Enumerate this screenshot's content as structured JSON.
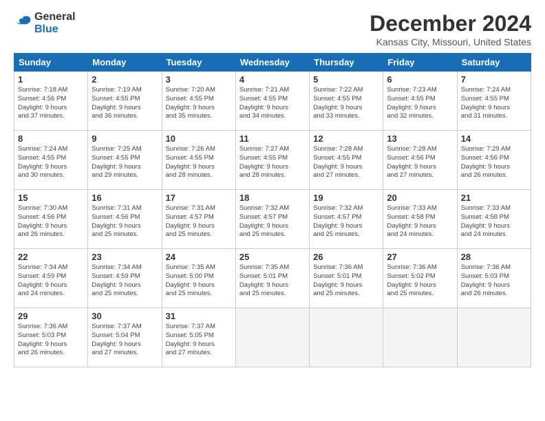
{
  "header": {
    "logo_line1": "General",
    "logo_line2": "Blue",
    "month_title": "December 2024",
    "location": "Kansas City, Missouri, United States"
  },
  "weekdays": [
    "Sunday",
    "Monday",
    "Tuesday",
    "Wednesday",
    "Thursday",
    "Friday",
    "Saturday"
  ],
  "weeks": [
    [
      {
        "day": "1",
        "info": "Sunrise: 7:18 AM\nSunset: 4:56 PM\nDaylight: 9 hours\nand 37 minutes."
      },
      {
        "day": "2",
        "info": "Sunrise: 7:19 AM\nSunset: 4:55 PM\nDaylight: 9 hours\nand 36 minutes."
      },
      {
        "day": "3",
        "info": "Sunrise: 7:20 AM\nSunset: 4:55 PM\nDaylight: 9 hours\nand 35 minutes."
      },
      {
        "day": "4",
        "info": "Sunrise: 7:21 AM\nSunset: 4:55 PM\nDaylight: 9 hours\nand 34 minutes."
      },
      {
        "day": "5",
        "info": "Sunrise: 7:22 AM\nSunset: 4:55 PM\nDaylight: 9 hours\nand 33 minutes."
      },
      {
        "day": "6",
        "info": "Sunrise: 7:23 AM\nSunset: 4:55 PM\nDaylight: 9 hours\nand 32 minutes."
      },
      {
        "day": "7",
        "info": "Sunrise: 7:24 AM\nSunset: 4:55 PM\nDaylight: 9 hours\nand 31 minutes."
      }
    ],
    [
      {
        "day": "8",
        "info": "Sunrise: 7:24 AM\nSunset: 4:55 PM\nDaylight: 9 hours\nand 30 minutes."
      },
      {
        "day": "9",
        "info": "Sunrise: 7:25 AM\nSunset: 4:55 PM\nDaylight: 9 hours\nand 29 minutes."
      },
      {
        "day": "10",
        "info": "Sunrise: 7:26 AM\nSunset: 4:55 PM\nDaylight: 9 hours\nand 28 minutes."
      },
      {
        "day": "11",
        "info": "Sunrise: 7:27 AM\nSunset: 4:55 PM\nDaylight: 9 hours\nand 28 minutes."
      },
      {
        "day": "12",
        "info": "Sunrise: 7:28 AM\nSunset: 4:55 PM\nDaylight: 9 hours\nand 27 minutes."
      },
      {
        "day": "13",
        "info": "Sunrise: 7:28 AM\nSunset: 4:56 PM\nDaylight: 9 hours\nand 27 minutes."
      },
      {
        "day": "14",
        "info": "Sunrise: 7:29 AM\nSunset: 4:56 PM\nDaylight: 9 hours\nand 26 minutes."
      }
    ],
    [
      {
        "day": "15",
        "info": "Sunrise: 7:30 AM\nSunset: 4:56 PM\nDaylight: 9 hours\nand 26 minutes."
      },
      {
        "day": "16",
        "info": "Sunrise: 7:31 AM\nSunset: 4:56 PM\nDaylight: 9 hours\nand 25 minutes."
      },
      {
        "day": "17",
        "info": "Sunrise: 7:31 AM\nSunset: 4:57 PM\nDaylight: 9 hours\nand 25 minutes."
      },
      {
        "day": "18",
        "info": "Sunrise: 7:32 AM\nSunset: 4:57 PM\nDaylight: 9 hours\nand 25 minutes."
      },
      {
        "day": "19",
        "info": "Sunrise: 7:32 AM\nSunset: 4:57 PM\nDaylight: 9 hours\nand 25 minutes."
      },
      {
        "day": "20",
        "info": "Sunrise: 7:33 AM\nSunset: 4:58 PM\nDaylight: 9 hours\nand 24 minutes."
      },
      {
        "day": "21",
        "info": "Sunrise: 7:33 AM\nSunset: 4:58 PM\nDaylight: 9 hours\nand 24 minutes."
      }
    ],
    [
      {
        "day": "22",
        "info": "Sunrise: 7:34 AM\nSunset: 4:59 PM\nDaylight: 9 hours\nand 24 minutes."
      },
      {
        "day": "23",
        "info": "Sunrise: 7:34 AM\nSunset: 4:59 PM\nDaylight: 9 hours\nand 25 minutes."
      },
      {
        "day": "24",
        "info": "Sunrise: 7:35 AM\nSunset: 5:00 PM\nDaylight: 9 hours\nand 25 minutes."
      },
      {
        "day": "25",
        "info": "Sunrise: 7:35 AM\nSunset: 5:01 PM\nDaylight: 9 hours\nand 25 minutes."
      },
      {
        "day": "26",
        "info": "Sunrise: 7:36 AM\nSunset: 5:01 PM\nDaylight: 9 hours\nand 25 minutes."
      },
      {
        "day": "27",
        "info": "Sunrise: 7:36 AM\nSunset: 5:02 PM\nDaylight: 9 hours\nand 25 minutes."
      },
      {
        "day": "28",
        "info": "Sunrise: 7:36 AM\nSunset: 5:03 PM\nDaylight: 9 hours\nand 26 minutes."
      }
    ],
    [
      {
        "day": "29",
        "info": "Sunrise: 7:36 AM\nSunset: 5:03 PM\nDaylight: 9 hours\nand 26 minutes."
      },
      {
        "day": "30",
        "info": "Sunrise: 7:37 AM\nSunset: 5:04 PM\nDaylight: 9 hours\nand 27 minutes."
      },
      {
        "day": "31",
        "info": "Sunrise: 7:37 AM\nSunset: 5:05 PM\nDaylight: 9 hours\nand 27 minutes."
      },
      null,
      null,
      null,
      null
    ]
  ]
}
